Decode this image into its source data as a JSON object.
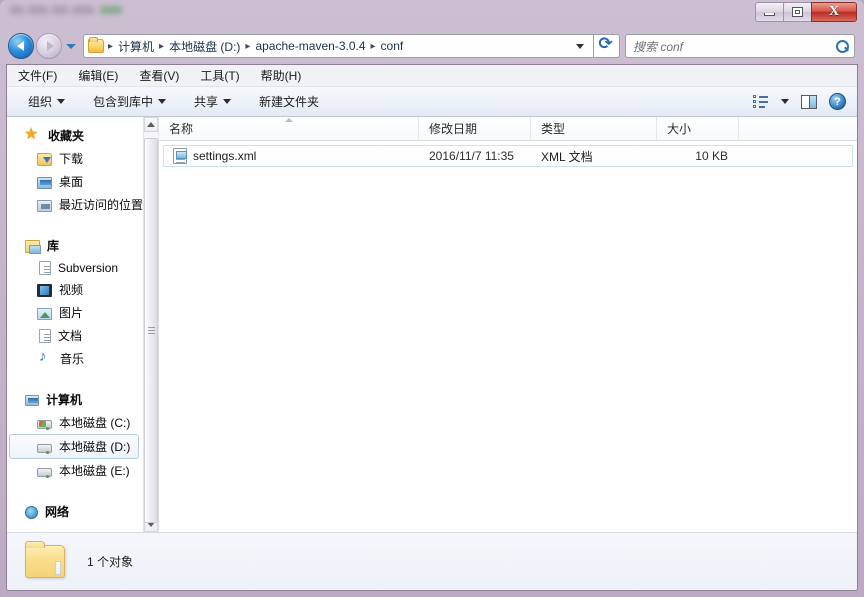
{
  "window": {
    "title_obscured": true,
    "controls": {
      "minimize": "minimize",
      "maximize": "maximize",
      "close": "X"
    }
  },
  "nav": {
    "back_tooltip": "后退",
    "forward_tooltip": "前进",
    "recent_tooltip": "最近浏览的位置",
    "breadcrumbs": [
      "计算机",
      "本地磁盘 (D:)",
      "apache-maven-3.0.4",
      "conf"
    ],
    "separator": "▸",
    "refresh_label": "刷新"
  },
  "search": {
    "placeholder": "搜索 conf",
    "value": ""
  },
  "menubar": {
    "items": [
      {
        "label": "文件(F)",
        "key": "F"
      },
      {
        "label": "编辑(E)",
        "key": "E"
      },
      {
        "label": "查看(V)",
        "key": "V"
      },
      {
        "label": "工具(T)",
        "key": "T"
      },
      {
        "label": "帮助(H)",
        "key": "H"
      }
    ]
  },
  "toolbar": {
    "organize": "组织",
    "include_in_library": "包含到库中",
    "share": "共享",
    "new_folder": "新建文件夹",
    "help_glyph": "?"
  },
  "sidebar": {
    "groups": [
      {
        "header": "收藏夹",
        "header_icon": "star-icon",
        "items": [
          {
            "label": "下载",
            "icon": "downloads-icon"
          },
          {
            "label": "桌面",
            "icon": "desktop-icon"
          },
          {
            "label": "最近访问的位置",
            "icon": "recent-places-icon"
          }
        ]
      },
      {
        "header": "库",
        "header_icon": "library-icon",
        "items": [
          {
            "label": "Subversion",
            "icon": "document-icon"
          },
          {
            "label": "视频",
            "icon": "video-icon"
          },
          {
            "label": "图片",
            "icon": "picture-icon"
          },
          {
            "label": "文档",
            "icon": "document-icon"
          },
          {
            "label": "音乐",
            "icon": "music-icon"
          }
        ]
      },
      {
        "header": "计算机",
        "header_icon": "computer-icon",
        "items": [
          {
            "label": "本地磁盘 (C:)",
            "icon": "system-drive-icon",
            "selected": false
          },
          {
            "label": "本地磁盘 (D:)",
            "icon": "drive-icon",
            "selected": true
          },
          {
            "label": "本地磁盘 (E:)",
            "icon": "drive-icon",
            "selected": false
          }
        ]
      },
      {
        "header": "网络",
        "header_icon": "network-icon",
        "items": []
      }
    ]
  },
  "filelist": {
    "columns": [
      {
        "label": "名称",
        "sorted": true
      },
      {
        "label": "修改日期",
        "sorted": false
      },
      {
        "label": "类型",
        "sorted": false
      },
      {
        "label": "大小",
        "sorted": false
      }
    ],
    "rows": [
      {
        "name": "settings.xml",
        "date": "2016/11/7 11:35",
        "type": "XML 文档",
        "size": "10 KB",
        "icon": "xml-file-icon"
      }
    ]
  },
  "statusbar": {
    "count_text": "1 个对象",
    "icon": "folder-icon"
  },
  "colors": {
    "frame": "#c6b6cc",
    "accent_blue": "#2f7fc0",
    "close_red": "#bb2d22",
    "selection_border": "#b4cce4",
    "folder_yellow": "#f5d277"
  }
}
